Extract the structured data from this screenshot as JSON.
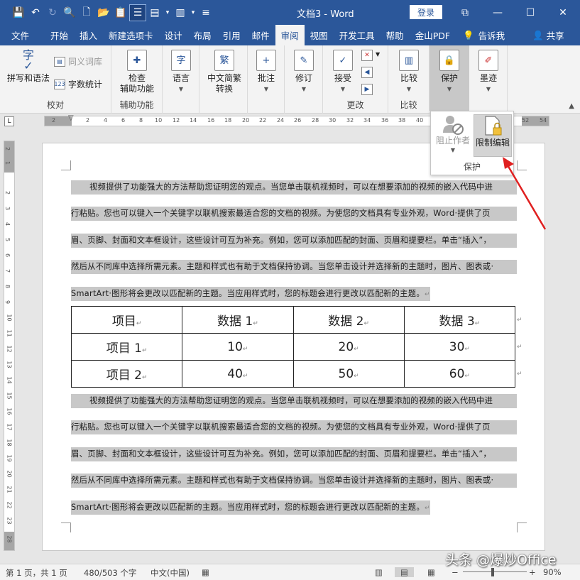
{
  "window": {
    "title": "文档3  -  Word",
    "login": "登录",
    "controls": [
      "⧉",
      "—",
      "☐",
      "✕"
    ]
  },
  "qat": [
    "💾",
    "↶",
    "↻",
    "🔍",
    "🗋",
    "📂",
    "📋",
    "☰",
    "▤",
    "▾",
    "▥",
    "▾",
    "≡",
    "▾"
  ],
  "tabs": [
    "文件",
    "开始",
    "插入",
    "新建选项卡",
    "设计",
    "布局",
    "引用",
    "邮件",
    "审阅",
    "视图",
    "开发工具",
    "帮助",
    "金山PDF"
  ],
  "active_tab": "审阅",
  "tab_extra": {
    "tell_me": "告诉我",
    "share": "共享"
  },
  "ribbon": {
    "proofing": {
      "label": "校对",
      "spell": "拼写和语法",
      "thesaurus": "同义词库",
      "wordcount": "字数统计"
    },
    "accessibility": {
      "label": "辅助功能",
      "check": "检查\n辅助功能"
    },
    "language": {
      "btn": "语言"
    },
    "chinese": {
      "btn": "中文简繁\n转换"
    },
    "comments": {
      "btn": "批注"
    },
    "tracking": {
      "btn": "修订"
    },
    "changes": {
      "label": "更改",
      "accept": "接受"
    },
    "compare": {
      "label": "比较",
      "btn": "比较"
    },
    "protect": {
      "btn": "保护"
    },
    "ink": {
      "btn": "墨迹"
    }
  },
  "popup": {
    "block_authors": "阻止作者",
    "restrict_editing": "限制编辑",
    "label": "保护"
  },
  "ruler": {
    "h_numbers": [
      "2",
      "2",
      "4",
      "6",
      "8",
      "10",
      "12",
      "14",
      "16",
      "18",
      "20",
      "22",
      "24",
      "26",
      "28",
      "30",
      "32",
      "34",
      "36",
      "38",
      "40",
      "42",
      "44",
      "46",
      "48",
      "52",
      "54"
    ],
    "v_numbers": [
      "2",
      "1",
      "2",
      "3",
      "4",
      "5",
      "6",
      "7",
      "8",
      "9",
      "10",
      "11",
      "12",
      "13",
      "14",
      "15",
      "16",
      "17",
      "18",
      "19",
      "20",
      "21",
      "22",
      "23",
      "24",
      "28"
    ]
  },
  "document": {
    "para1": [
      "视频提供了功能强大的方法帮助您证明您的观点。当您单击联机视频时，可以在想要添加的视频的嵌入代码中进",
      "行粘贴。您也可以键入一个关键字以联机搜索最适合您的文档的视频。为使您的文档具有专业外观，Word·提供了页",
      "眉、页脚、封面和文本框设计，这些设计可互为补充。例如，您可以添加匹配的封面、页眉和提要栏。单击“插入”，",
      "然后从不同库中选择所需元素。主题和样式也有助于文档保持协调。当您单击设计并选择新的主题时，图片、图表或·",
      "SmartArt·图形将会更改以匹配新的主题。当应用样式时，您的标题会进行更改以匹配新的主题。"
    ],
    "para2": [
      "视频提供了功能强大的方法帮助您证明您的观点。当您单击联机视频时，可以在想要添加的视频的嵌入代码中进",
      "行粘贴。您也可以键入一个关键字以联机搜索最适合您的文档的视频。为使您的文档具有专业外观，Word·提供了页",
      "眉、页脚、封面和文本框设计，这些设计可互为补充。例如，您可以添加匹配的封面、页眉和提要栏。单击“插入”，",
      "然后从不同库中选择所需元素。主题和样式也有助于文档保持协调。当您单击设计并选择新的主题时，图片、图表或·",
      "SmartArt·图形将会更改以匹配新的主题。当应用样式时，您的标题会进行更改以匹配新的主题。"
    ],
    "para_mark": "↵",
    "table": [
      [
        "项目",
        "数据 1",
        "数据 2",
        "数据 3"
      ],
      [
        "项目 1",
        "10",
        "20",
        "30"
      ],
      [
        "项目 2",
        "40",
        "50",
        "60"
      ]
    ]
  },
  "status": {
    "page": "第 1 页，共 1 页",
    "words": "480/503 个字",
    "lang": "中文(中国)",
    "zoom": "90%"
  },
  "watermark": "头条 @爆炒Office",
  "colors": {
    "title_bar": "#2b579a",
    "selection": "#c8c8c8",
    "arrow": "#e02020"
  }
}
